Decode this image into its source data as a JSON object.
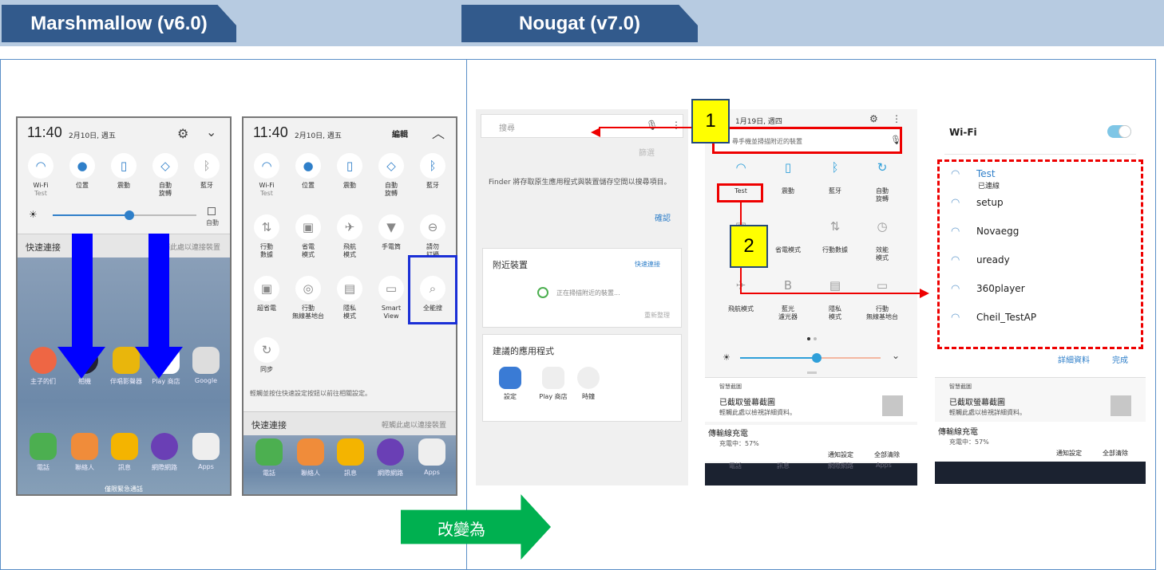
{
  "header": {
    "left_tab": "Marshmallow (v6.0)",
    "right_tab": "Nougat (v7.0)"
  },
  "m1": {
    "time": "11:40",
    "date": "2月10日, 週五",
    "tiles": [
      {
        "label": "Wi-Fi",
        "sub": "Test",
        "icon": "wifi-icon"
      },
      {
        "label": "位置",
        "icon": "location-icon"
      },
      {
        "label": "震動",
        "icon": "vibrate-icon"
      },
      {
        "label": "自動\n旋轉",
        "icon": "rotate-icon"
      },
      {
        "label": "藍牙",
        "icon": "bluetooth-icon"
      }
    ],
    "auto": "自動",
    "quick": "快速連接",
    "quick_hint": "輕觸此處以連接裝置",
    "apps": [
      "主子的们",
      "相機",
      "伴唱影聲器",
      "Play 商店",
      "Google"
    ],
    "dock": [
      "電話",
      "聯絡人",
      "訊息",
      "網際網路",
      "Apps"
    ],
    "emergency": "僅限緊急通話"
  },
  "m2": {
    "time": "11:40",
    "date": "2月10日, 週五",
    "edit": "編輯",
    "tiles": [
      "Wi-Fi",
      "位置",
      "震動",
      "自動\n旋轉",
      "藍牙",
      "行動\n數據",
      "省電\n模式",
      "飛航\n模式",
      "手電筒",
      "請勿\n打擾",
      "超省電",
      "行動\n無線基地台",
      "隱私\n模式",
      "Smart\nView",
      "全能搜",
      "同步"
    ],
    "wifi_sub": "Test",
    "hint": "輕觸並按住快速設定按鈕以前往相關設定。",
    "quick": "快速連接",
    "quick_hint": "輕觸此處以連接裝置",
    "dock": [
      "電話",
      "聯絡人",
      "訊息",
      "網際網路",
      "Apps"
    ]
  },
  "change_label": "改變為",
  "n1": {
    "search": "搜尋",
    "filter": "篩選",
    "finder": "Finder 將存取原生應用程式與裝置儲存空間以搜尋項目。",
    "confirm": "確認",
    "nearby": "附近裝置",
    "quick_link": "快速連接",
    "scanning": "正在掃描附近的裝置...",
    "rescan": "重新整理",
    "suggested": "建議的應用程式",
    "apps": [
      "設定",
      "Play 商店",
      "時鐘"
    ]
  },
  "n2": {
    "date": "1月19日, 週四",
    "search": "尋手機並掃描附近的裝置",
    "tiles": [
      "Test",
      "震動",
      "藍牙",
      "自動\n旋轉",
      "",
      "省電模式",
      "行動數據",
      "效能\n模式",
      "飛航模式",
      "藍光\n濾光器",
      "隱私\n模式",
      "行動\n無線基地台"
    ],
    "notif_app": "智慧截圖",
    "notif_title": "已截取螢幕截圖",
    "notif_body": "輕觸此處以檢視詳細資料。",
    "charge": "傳輸線充電",
    "charge_sub": "充電中：57%",
    "notif_settings": "通知設定",
    "clear_all": "全部清除",
    "dock": [
      "電話",
      "訊息",
      "網際網路",
      "Apps"
    ]
  },
  "n3": {
    "title": "Wi-Fi",
    "networks": [
      {
        "name": "Test",
        "sub": "已連線"
      },
      {
        "name": "setup"
      },
      {
        "name": "Novaegg"
      },
      {
        "name": "uready"
      },
      {
        "name": "360player"
      },
      {
        "name": "Cheil_TestAP"
      }
    ],
    "details": "詳細資料",
    "done": "完成",
    "notif_app": "智慧截圖",
    "notif_title": "已截取螢幕截圖",
    "notif_body": "輕觸此處以檢視詳細資料。",
    "charge": "傳輸線充電",
    "charge_sub": "充電中：57%",
    "notif_settings": "通知設定",
    "clear_all": "全部清除"
  },
  "callouts": {
    "one": "1",
    "two": "2"
  },
  "colors": {
    "tab": "#325a8c",
    "band": "#b7cbe1",
    "accent": "#2f7fc9",
    "red": "#e00000",
    "green": "#00b050",
    "callout": "#ffff00"
  }
}
